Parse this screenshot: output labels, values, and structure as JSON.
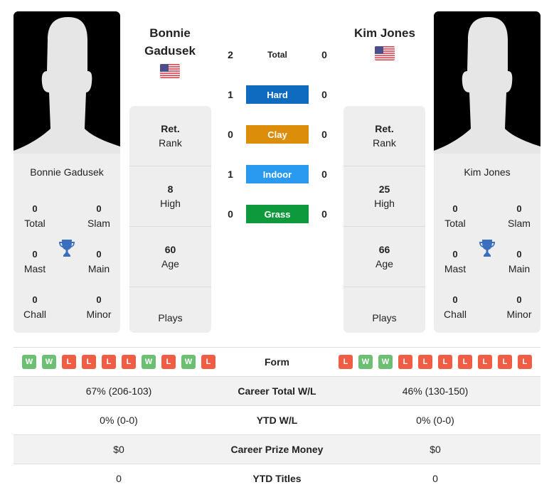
{
  "colors": {
    "hard": "#0e6bbf",
    "clay": "#dc8d0a",
    "indoor": "#2a9af0",
    "grass": "#0e9a3c",
    "win": "#6dbf73",
    "loss": "#ef5e44",
    "trophy": "#3a6fbf"
  },
  "player1": {
    "name": "Bonnie Gadusek",
    "header_name_line1": "Bonnie",
    "header_name_line2": "Gadusek",
    "flag_icon": "us-flag-icon",
    "titles": {
      "total": {
        "value": "0",
        "label": "Total"
      },
      "slam": {
        "value": "0",
        "label": "Slam"
      },
      "mast": {
        "value": "0",
        "label": "Mast"
      },
      "main": {
        "value": "0",
        "label": "Main"
      },
      "chall": {
        "value": "0",
        "label": "Chall"
      },
      "minor": {
        "value": "0",
        "label": "Minor"
      }
    },
    "rank": {
      "value": "Ret.",
      "label": "Rank"
    },
    "high": {
      "value": "8",
      "label": "High"
    },
    "age": {
      "value": "60",
      "label": "Age"
    },
    "plays": {
      "value": "",
      "label": "Plays"
    },
    "form": [
      "W",
      "W",
      "L",
      "L",
      "L",
      "L",
      "W",
      "L",
      "W",
      "L"
    ],
    "career_wl": "67% (206-103)",
    "ytd_wl": "0% (0-0)",
    "prize": "$0",
    "ytd_titles": "0"
  },
  "player2": {
    "name": "Kim Jones",
    "header_name_line1": "Kim Jones",
    "flag_icon": "us-flag-icon",
    "titles": {
      "total": {
        "value": "0",
        "label": "Total"
      },
      "slam": {
        "value": "0",
        "label": "Slam"
      },
      "mast": {
        "value": "0",
        "label": "Mast"
      },
      "main": {
        "value": "0",
        "label": "Main"
      },
      "chall": {
        "value": "0",
        "label": "Chall"
      },
      "minor": {
        "value": "0",
        "label": "Minor"
      }
    },
    "rank": {
      "value": "Ret.",
      "label": "Rank"
    },
    "high": {
      "value": "25",
      "label": "High"
    },
    "age": {
      "value": "66",
      "label": "Age"
    },
    "plays": {
      "value": "",
      "label": "Plays"
    },
    "form": [
      "L",
      "W",
      "W",
      "L",
      "L",
      "L",
      "L",
      "L",
      "L",
      "L"
    ],
    "career_wl": "46% (130-150)",
    "ytd_wl": "0% (0-0)",
    "prize": "$0",
    "ytd_titles": "0"
  },
  "h2h": {
    "total": {
      "label": "Total",
      "p1": "2",
      "p2": "0"
    },
    "hard": {
      "label": "Hard",
      "p1": "1",
      "p2": "0"
    },
    "clay": {
      "label": "Clay",
      "p1": "0",
      "p2": "0"
    },
    "indoor": {
      "label": "Indoor",
      "p1": "1",
      "p2": "0"
    },
    "grass": {
      "label": "Grass",
      "p1": "0",
      "p2": "0"
    }
  },
  "stats_labels": {
    "form": "Form",
    "career_wl": "Career Total W/L",
    "ytd_wl": "YTD W/L",
    "prize": "Career Prize Money",
    "ytd_titles": "YTD Titles"
  }
}
